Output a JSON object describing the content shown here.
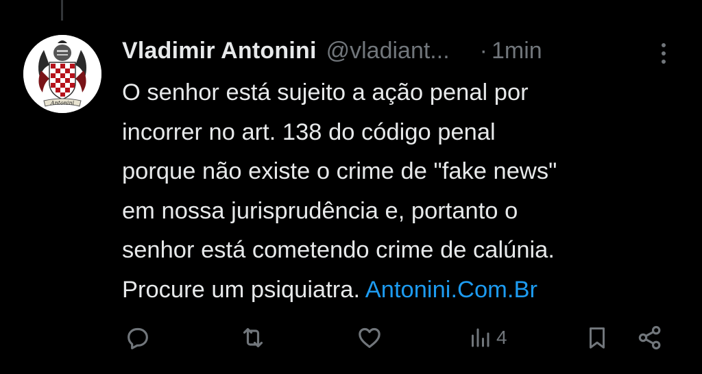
{
  "tweet": {
    "author_name": "Vladimir Antonini",
    "handle": "@vladiant...",
    "separator": "·",
    "time": "1min",
    "text_lines": [
      "O senhor está sujeito a ação penal por",
      "incorrer no art. 138 do código penal",
      "porque não existe o crime de \"fake news\"",
      "em nossa jurisprudência e, portanto o",
      "senhor está cometendo crime de calúnia.",
      "Procure um psiquiatra. "
    ],
    "link_text": "Antonini.Com.Br",
    "avatar_caption": "Antonini"
  },
  "actions": {
    "views_count": "4"
  },
  "icons": {
    "reply": "reply-icon",
    "retweet": "retweet-icon",
    "like": "heart-icon",
    "views": "views-chart-icon",
    "bookmark": "bookmark-icon",
    "share": "share-icon",
    "more": "more-vertical-icon"
  },
  "colors": {
    "background": "#000000",
    "text": "#e7e9ea",
    "muted": "#71767b",
    "link": "#1d9bf0"
  }
}
